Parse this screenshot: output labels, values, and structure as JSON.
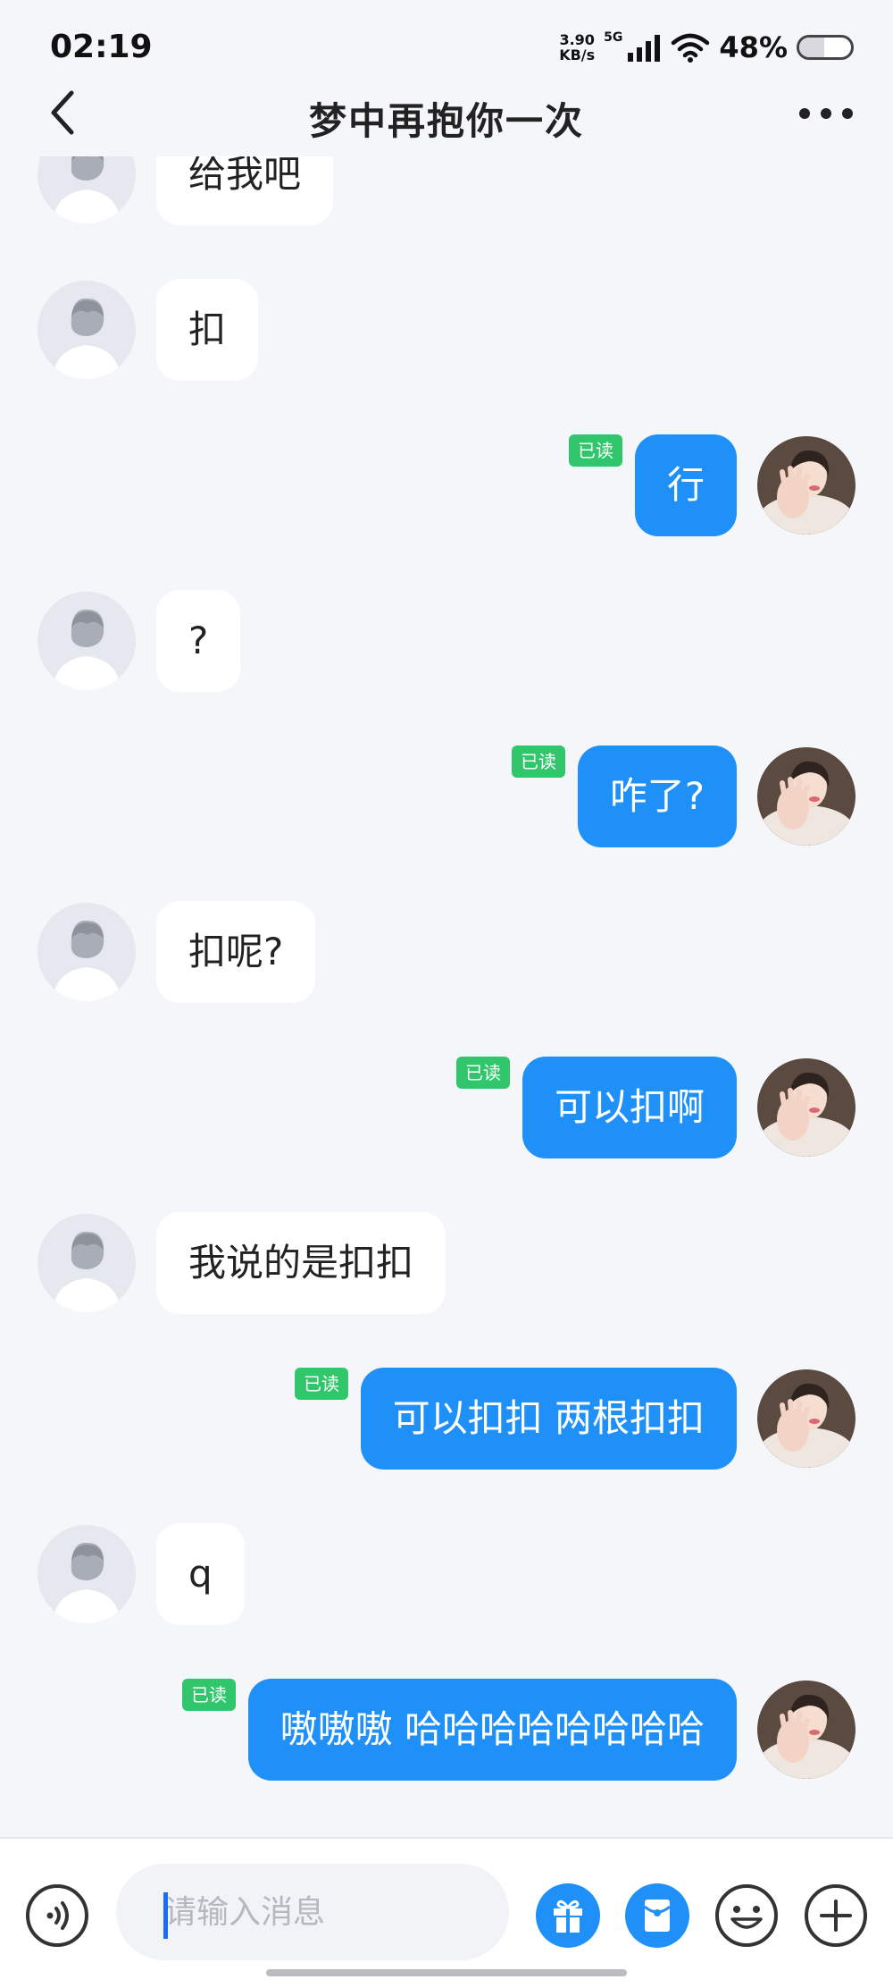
{
  "status_bar": {
    "time": "02:19",
    "net_speed_value": "3.90",
    "net_speed_unit": "KB/s",
    "network": "5G",
    "battery_percent": "48%",
    "battery_level": 0.48
  },
  "header": {
    "title": "梦中再抱你一次",
    "back_icon": "chevron-left-icon",
    "more_icon": "more-dots-icon"
  },
  "messages": [
    {
      "side": "in",
      "text": "给我吧"
    },
    {
      "side": "in",
      "text": "扣"
    },
    {
      "side": "out",
      "text": "行",
      "status": "已读"
    },
    {
      "side": "in",
      "text": "?"
    },
    {
      "side": "out",
      "text": "咋了?",
      "status": "已读"
    },
    {
      "side": "in",
      "text": "扣呢?"
    },
    {
      "side": "out",
      "text": "可以扣啊",
      "status": "已读"
    },
    {
      "side": "in",
      "text": "我说的是扣扣"
    },
    {
      "side": "out",
      "text": "可以扣扣 两根扣扣",
      "status": "已读"
    },
    {
      "side": "in",
      "text": "q"
    },
    {
      "side": "out",
      "text": "嗷嗷嗷 哈哈哈哈哈哈哈哈",
      "status": "已读"
    }
  ],
  "input_bar": {
    "placeholder": "请输入消息",
    "icons": [
      "voice-icon",
      "gift-icon",
      "red-packet-icon",
      "emoji-icon",
      "plus-icon"
    ]
  },
  "colors": {
    "outgoing_bubble": "#1e90f8",
    "incoming_bubble": "#ffffff",
    "read_badge": "#32c66c",
    "background": "#f4f6f9"
  }
}
